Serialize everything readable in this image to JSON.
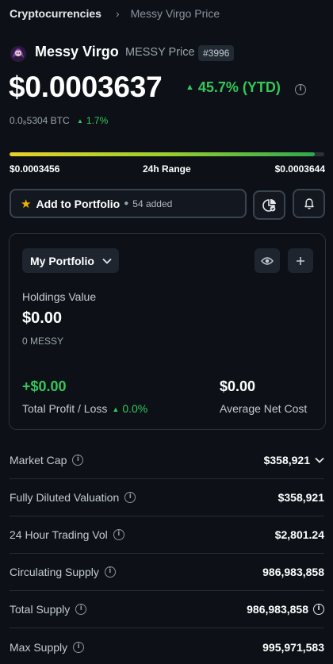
{
  "breadcrumb": {
    "parent": "Cryptocurrencies",
    "current": "Messy Virgo Price"
  },
  "coin": {
    "name": "Messy Virgo",
    "symbol_label": "MESSY Price",
    "rank": "#3996",
    "price": "$0.0003637",
    "change": "45.7% (YTD)",
    "btc_price": "0.0₈5304 BTC",
    "btc_change": "1.7%"
  },
  "range": {
    "low": "$0.0003456",
    "label": "24h Range",
    "high": "$0.0003644",
    "fill_fraction": 0.97
  },
  "actions": {
    "add_portfolio": "Add to Portfolio",
    "added_count": "54 added"
  },
  "portfolio": {
    "selector": "My Portfolio",
    "holdings_label": "Holdings Value",
    "holdings_value": "$0.00",
    "holdings_amount": "0 MESSY",
    "profit_value": "+$0.00",
    "profit_label": "Total Profit / Loss",
    "profit_pct": "0.0%",
    "avg_cost_value": "$0.00",
    "avg_cost_label": "Average Net Cost"
  },
  "stats": [
    {
      "label": "Market Cap",
      "value": "$358,921"
    },
    {
      "label": "Fully Diluted Valuation",
      "value": "$358,921"
    },
    {
      "label": "24 Hour Trading Vol",
      "value": "$2,801.24"
    },
    {
      "label": "Circulating Supply",
      "value": "986,983,858"
    },
    {
      "label": "Total Supply",
      "value": "986,983,858"
    },
    {
      "label": "Max Supply",
      "value": "995,971,583"
    }
  ],
  "colors": {
    "background": "#0d1117",
    "positive": "#34c759",
    "star": "#f5b301",
    "range_start": "#e9d12a",
    "range_end": "#2fa84f"
  }
}
